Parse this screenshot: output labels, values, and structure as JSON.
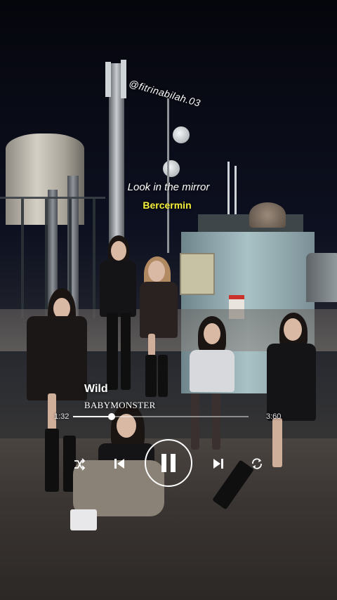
{
  "overlay": {
    "watermark": "@fitrinabilah.03",
    "lyric_original": "Look in the mirror",
    "lyric_translation": "Bercermin",
    "translation_color": "#f4ef3a"
  },
  "player": {
    "song_title": "Wild",
    "artist": "BABYMONSTER",
    "elapsed": "1:32",
    "total": "3:60",
    "progress": 0.22,
    "controls": {
      "shuffle": "shuffle-icon",
      "previous": "skip-previous-icon",
      "play_pause": "pause-icon",
      "next": "skip-next-icon",
      "repeat": "repeat-icon"
    }
  }
}
